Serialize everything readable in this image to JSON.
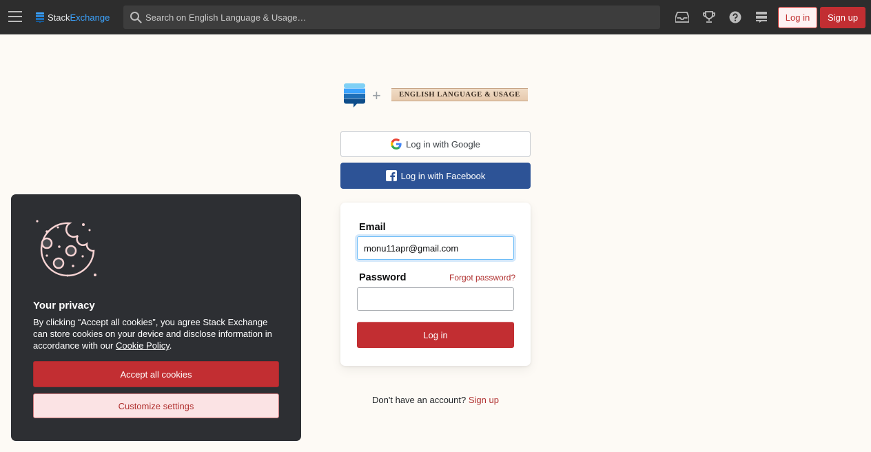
{
  "topbar": {
    "logo_text_1": "Stack",
    "logo_text_2": "Exchange",
    "search_placeholder": "Search on English Language & Usage…",
    "login_label": "Log in",
    "signup_label": "Sign up",
    "icons": [
      "inbox-icon",
      "achievements-icon",
      "help-icon",
      "site-switcher-icon"
    ]
  },
  "site_logo": {
    "text": "ENGLISH LANGUAGE & USAGE"
  },
  "social": {
    "google_label": "Log in with Google",
    "facebook_label": "Log in with Facebook"
  },
  "login_form": {
    "email_label": "Email",
    "email_value": "monu11apr@gmail.com",
    "password_label": "Password",
    "forgot_label": "Forgot password?",
    "password_value": "",
    "submit_label": "Log in"
  },
  "signup_prompt": {
    "text": "Don't have an account?",
    "link": "Sign up"
  },
  "cookie_banner": {
    "title": "Your privacy",
    "text_before": "By clicking “Accept all cookies”, you agree Stack Exchange can store cookies on your device and disclose information in accordance with our ",
    "policy_link": "Cookie Policy",
    "text_after": ".",
    "accept_label": "Accept all cookies",
    "customize_label": "Customize settings"
  },
  "colors": {
    "topbar_bg": "#2d2d2d",
    "brand_red": "#c22e32",
    "facebook_blue": "#2d5396",
    "page_bg": "#fdfaf5",
    "cookie_bg": "#2d2f33"
  }
}
